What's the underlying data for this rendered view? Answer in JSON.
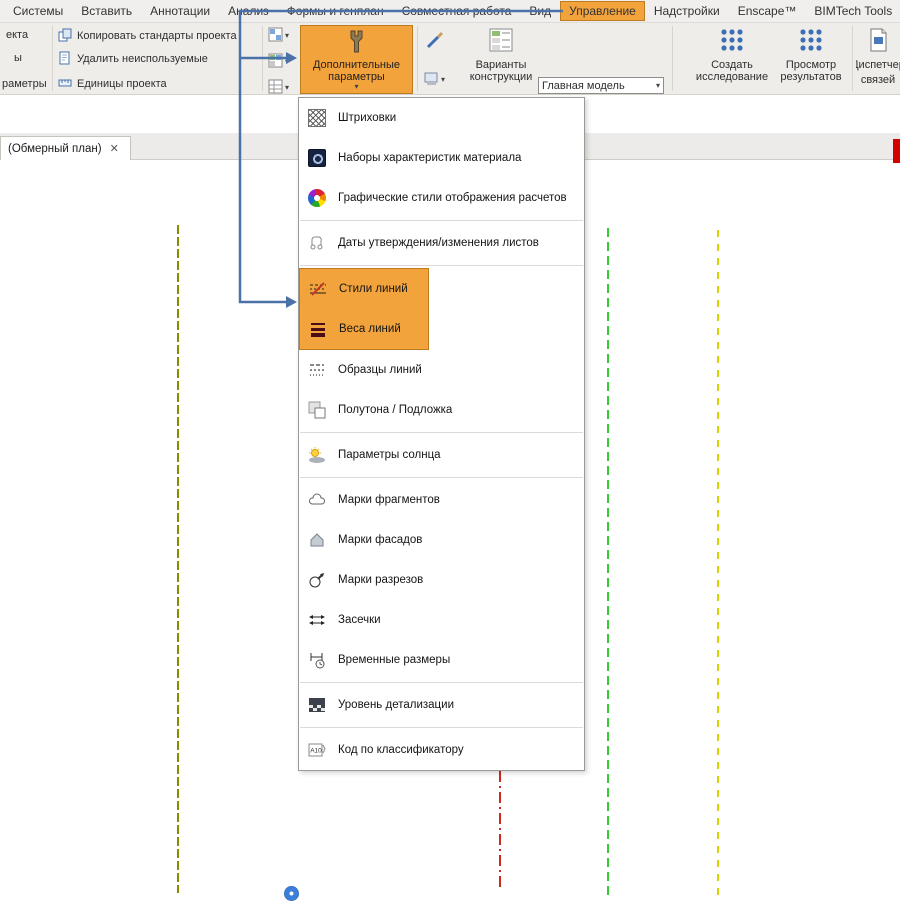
{
  "colors": {
    "accent": "#f3a33c",
    "accent_border": "#bc7c1e",
    "arrow_blue": "#4a72a8",
    "line_olive": "#8b8b00",
    "line_red": "#cc2a1f",
    "line_green": "#33cc33",
    "line_yellow": "#d4d400",
    "red_bar": "#d40000"
  },
  "icons": {
    "dropdown": "▾",
    "close": "✕",
    "classifier_text": "A10"
  },
  "tabs": [
    "Системы",
    "Вставить",
    "Аннотации",
    "Анализ",
    "Формы и генплан",
    "Совместная работа",
    "Вид",
    "Управление",
    "Надстройки",
    "Enscape™",
    "BIMTech Tools"
  ],
  "ribbon": {
    "truncated_left": [
      "екта",
      "ы",
      "раметры"
    ],
    "tools": [
      "Копировать стандарты проекта",
      "Удалить неиспользуемые",
      "Единицы проекта"
    ],
    "additional_parameters": "Дополнительные параметры",
    "design_options": "Варианты конструкции",
    "active_option": "Главная модель",
    "create_study": "Создать исследование",
    "view_results": "Просмотр результатов",
    "links_manager_line1": "Диспетчер",
    "links_manager_line2": "связей"
  },
  "view_tab": {
    "label": "(Обмерный план)"
  },
  "menu": {
    "items": [
      {
        "label": "Штриховки"
      },
      {
        "label": "Наборы характеристик материала"
      },
      {
        "label": "Графические стили отображения расчетов"
      },
      {
        "label": "Даты утверждения/изменения листов"
      },
      {
        "label": "Стили линий",
        "highlighted": true
      },
      {
        "label": "Веса линий",
        "highlighted": true
      },
      {
        "label": "Образцы линий"
      },
      {
        "label": "Полутона / Подложка"
      },
      {
        "label": "Параметры солнца"
      },
      {
        "label": "Марки фрагментов"
      },
      {
        "label": "Марки фасадов"
      },
      {
        "label": "Марки разрезов"
      },
      {
        "label": "Засечки"
      },
      {
        "label": "Временные размеры"
      },
      {
        "label": "Уровень детализации"
      },
      {
        "label": "Код по классификатору"
      }
    ]
  }
}
